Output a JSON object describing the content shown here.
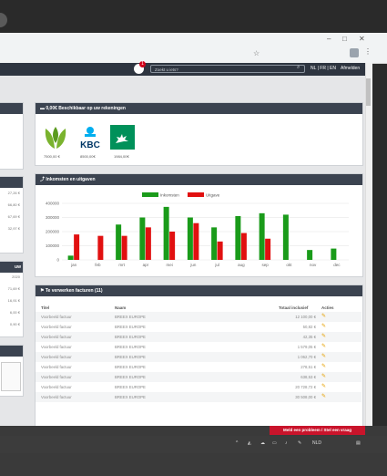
{
  "browser": {
    "star_icon": "star-icon",
    "window_buttons": [
      "–",
      "□",
      "✕"
    ]
  },
  "header": {
    "notification_count": "1",
    "search_placeholder": "Zoekt u iets?",
    "languages": "NL | FR | EN",
    "logout": "Afmelden"
  },
  "left_panels": {
    "values_1": [
      "27,26 €",
      "66,80 €",
      "67,69 €",
      "32,97 €"
    ],
    "header_2_fragment": "uw",
    "values_2": [
      "2020",
      "71,69 €",
      "16,91 €",
      "6,00 €",
      "0,90 €"
    ]
  },
  "bank_panel": {
    "title": "0,00€ Beschikbaar op uw rekeningen",
    "accounts": [
      {
        "amount": "7500,00 €",
        "logo": "leaf-logo"
      },
      {
        "amount": "8500,00€",
        "logo": "kbc-logo"
      },
      {
        "amount": "1984,00€",
        "logo": "bnp-logo"
      }
    ],
    "logo_text_kbc": "KBC"
  },
  "chart_panel": {
    "title": "Inkomsten en uitgaven"
  },
  "chart_data": {
    "type": "bar",
    "categories": [
      "jan",
      "feb",
      "mrt",
      "apr",
      "mei",
      "jun",
      "jul",
      "aug",
      "sep",
      "okt",
      "nov",
      "dec"
    ],
    "series": [
      {
        "name": "Inkomsten",
        "color": "#1a9b1a",
        "values": [
          30000,
          0,
          250000,
          300000,
          375000,
          300000,
          230000,
          310000,
          330000,
          320000,
          70000,
          80000
        ]
      },
      {
        "name": "Uitgave",
        "color": "#e11010",
        "values": [
          180000,
          170000,
          170000,
          230000,
          200000,
          260000,
          130000,
          190000,
          150000,
          0,
          0,
          0
        ]
      }
    ],
    "yticks": [
      "400000",
      "300000",
      "200000",
      "100000",
      "0"
    ],
    "ylim": [
      0,
      400000
    ],
    "legend": "top"
  },
  "invoices": {
    "title": "Te verwerken facturen (11)",
    "columns": [
      "Titel",
      "Naam",
      "Totaal inclusief",
      "Acties"
    ],
    "rows": [
      {
        "title": "Voorbeeld factuur",
        "name": "BREEX EUROPE",
        "total": "12 100,00 €"
      },
      {
        "title": "Voorbeeld factuur",
        "name": "BREEX EUROPE",
        "total": "50,82 €"
      },
      {
        "title": "Voorbeeld factuur",
        "name": "BREEX EUROPE",
        "total": "42,35 €"
      },
      {
        "title": "Voorbeeld factuur",
        "name": "BREEX EUROPE",
        "total": "1 579,05 €"
      },
      {
        "title": "Voorbeeld factuur",
        "name": "BREEX EUROPE",
        "total": "1 062,70 €"
      },
      {
        "title": "Voorbeeld factuur",
        "name": "BREEX EUROPE",
        "total": "278,51 €"
      },
      {
        "title": "Voorbeeld factuur",
        "name": "BREEX EUROPE",
        "total": "638,53 €"
      },
      {
        "title": "Voorbeeld factuur",
        "name": "BREEX EUROPE",
        "total": "20 728,72 €"
      },
      {
        "title": "Voorbeeld factuur",
        "name": "BREEX EUROPE",
        "total": "30 508,00 €"
      }
    ]
  },
  "report_button": "Meld een probleem / Stel een vraag",
  "taskbar": {
    "lang": "NLD"
  }
}
